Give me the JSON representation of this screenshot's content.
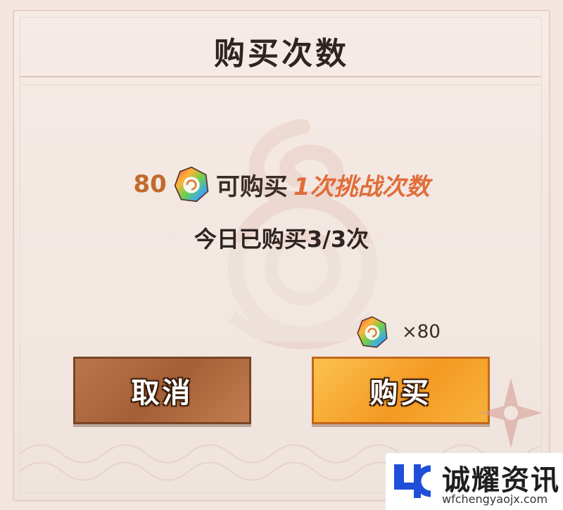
{
  "dialog": {
    "title": "购买次数",
    "price_amount": "80",
    "price_text": "可购买",
    "price_highlight": "1次挑战次数",
    "daily_status": "今日已购买3/3次",
    "cost_label": "×80",
    "cancel_label": "取消",
    "buy_label": "购买"
  },
  "icons": {
    "currency": "rainbow-gem-icon",
    "decoration": "shuriken-icon"
  },
  "watermark_logo": {
    "title": "诚耀资讯",
    "url": "wfchengyaojx.com"
  },
  "colors": {
    "price_amount": "#c26a2c",
    "highlight": "#e06d3a",
    "cancel_button": "#a45f36",
    "buy_button": "#f49a23",
    "logo_blue": "#1f4fd8"
  }
}
